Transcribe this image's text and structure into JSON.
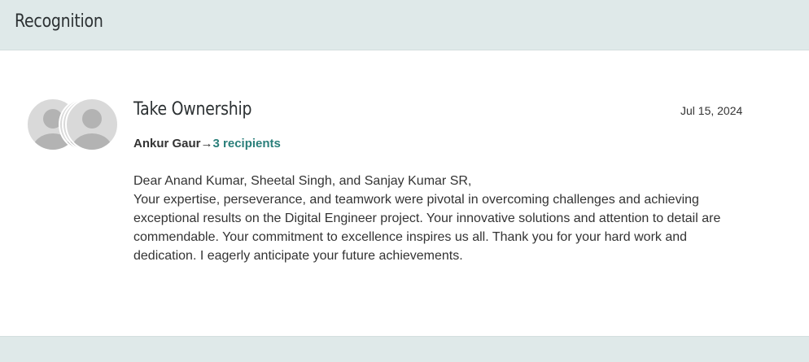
{
  "header": {
    "title": "Recognition"
  },
  "recognition": {
    "title": "Take Ownership",
    "date": "Jul 15, 2024",
    "sender": "Ankur Gaur",
    "arrow": "→",
    "recipients_link": "3 recipients",
    "message": {
      "greeting": "Dear Anand Kumar, Sheetal Singh, and Sanjay Kumar SR,",
      "line1": "Your expertise, perseverance, and teamwork were pivotal in overcoming challenges and achieving",
      "line2": "exceptional results on the Digital Engineer project. Your innovative solutions and attention to detail are",
      "line3": "commendable. Your commitment to excellence inspires us all. Thank you for your hard work and",
      "line4": "dedication. I eagerly anticipate your future achievements."
    },
    "avatars": [
      {
        "icon": "person-avatar-icon",
        "role": "sender"
      },
      {
        "icon": "person-avatar-icon",
        "role": "recipient"
      },
      {
        "icon": "person-avatar-icon",
        "role": "recipient"
      },
      {
        "icon": "person-avatar-icon",
        "role": "recipient"
      }
    ]
  },
  "colors": {
    "header_bg": "#dfe9e9",
    "card_bg": "#ffffff",
    "link": "#2a7f7a",
    "text": "#333333",
    "avatar_bg": "#d9d9d9",
    "avatar_fg": "#b3b3b3"
  }
}
